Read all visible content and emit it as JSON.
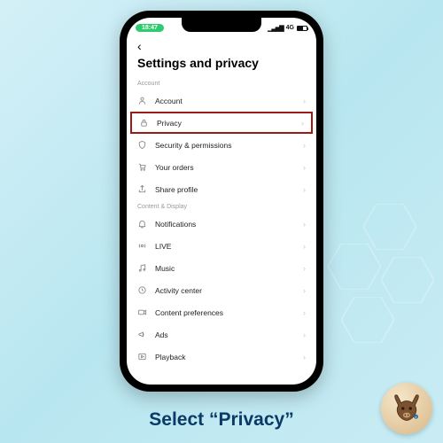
{
  "statusbar": {
    "time": "18:47",
    "network": "4G"
  },
  "header": {
    "title": "Settings and privacy"
  },
  "sections": {
    "account": {
      "label": "Account",
      "items": [
        {
          "label": "Account"
        },
        {
          "label": "Privacy"
        },
        {
          "label": "Security & permissions"
        },
        {
          "label": "Your orders"
        },
        {
          "label": "Share profile"
        }
      ]
    },
    "content": {
      "label": "Content & Display",
      "items": [
        {
          "label": "Notifications"
        },
        {
          "label": "LIVE"
        },
        {
          "label": "Music"
        },
        {
          "label": "Activity center"
        },
        {
          "label": "Content preferences"
        },
        {
          "label": "Ads"
        },
        {
          "label": "Playback"
        }
      ]
    }
  },
  "caption": "Select “Privacy”"
}
